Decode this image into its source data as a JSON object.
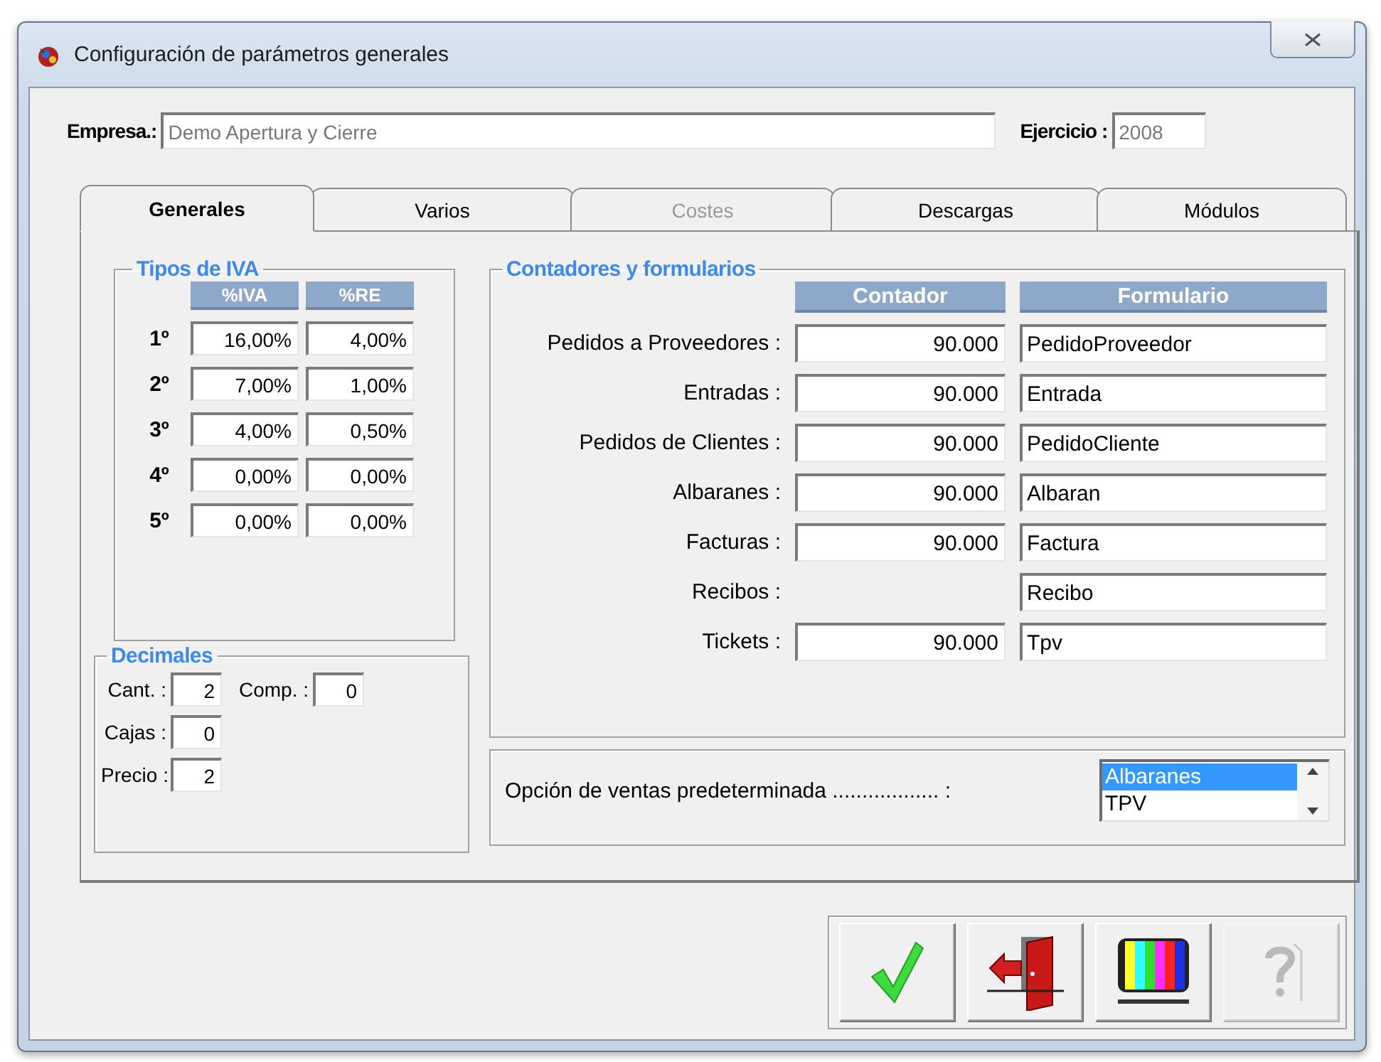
{
  "window": {
    "title": "Configuración de parámetros generales"
  },
  "header": {
    "company_label": "Empresa.:",
    "company_value": "Demo Apertura y Cierre",
    "year_label": "Ejercicio :",
    "year_value": "2008"
  },
  "tabs": [
    {
      "label": "Generales",
      "selected": true,
      "disabled": false
    },
    {
      "label": "Varios",
      "selected": false,
      "disabled": false
    },
    {
      "label": "Costes",
      "selected": false,
      "disabled": true
    },
    {
      "label": "Descargas",
      "selected": false,
      "disabled": false
    },
    {
      "label": "Módulos",
      "selected": false,
      "disabled": false
    }
  ],
  "iva": {
    "title": "Tipos de IVA",
    "columns": [
      "%IVA",
      "%RE"
    ],
    "rows": [
      {
        "label": "1º",
        "iva": "16,00%",
        "re": "4,00%"
      },
      {
        "label": "2º",
        "iva": "7,00%",
        "re": "1,00%"
      },
      {
        "label": "3º",
        "iva": "4,00%",
        "re": "0,50%"
      },
      {
        "label": "4º",
        "iva": "0,00%",
        "re": "0,00%"
      },
      {
        "label": "5º",
        "iva": "0,00%",
        "re": "0,00%"
      }
    ]
  },
  "decimals": {
    "title": "Decimales",
    "rows": [
      [
        {
          "label": "Cant. :",
          "value": "2"
        },
        {
          "label": "Comp. :",
          "value": "0"
        }
      ],
      [
        {
          "label": "Cajas :",
          "value": "0"
        }
      ],
      [
        {
          "label": "Precio :",
          "value": "2"
        }
      ]
    ]
  },
  "counters": {
    "title": "Contadores y formularios",
    "columns": [
      "Contador",
      "Formulario"
    ],
    "rows": [
      {
        "label": "Pedidos a Proveedores :",
        "counter": "90.000",
        "form": "PedidoProveedor"
      },
      {
        "label": "Entradas :",
        "counter": "90.000",
        "form": "Entrada"
      },
      {
        "label": "Pedidos de Clientes :",
        "counter": "90.000",
        "form": "PedidoCliente"
      },
      {
        "label": "Albaranes :",
        "counter": "90.000",
        "form": "Albaran"
      },
      {
        "label": "Facturas :",
        "counter": "90.000",
        "form": "Factura"
      },
      {
        "label": "Recibos :",
        "form": "Recibo"
      },
      {
        "label": "Tickets :",
        "counter": "90.000",
        "form": "Tpv"
      }
    ]
  },
  "sales_option": {
    "label": "Opción de ventas predeterminada .................. :",
    "options": [
      {
        "label": "Albaranes",
        "selected": true
      },
      {
        "label": "TPV",
        "selected": false
      }
    ]
  },
  "buttons": [
    {
      "kind": "accept",
      "disabled": false
    },
    {
      "kind": "exit",
      "disabled": false
    },
    {
      "kind": "screen",
      "disabled": false
    },
    {
      "kind": "help",
      "disabled": true
    }
  ]
}
